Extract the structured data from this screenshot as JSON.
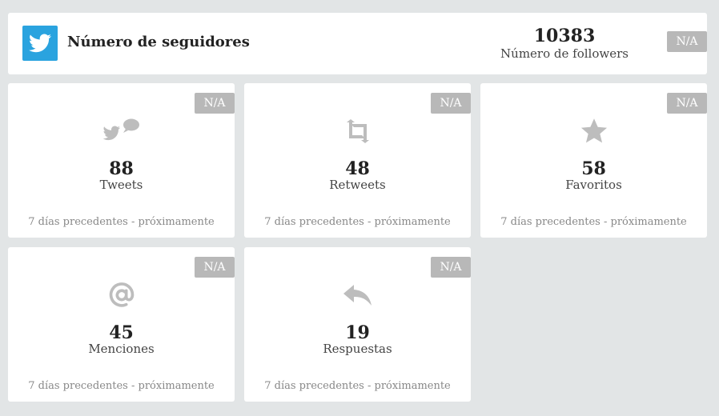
{
  "header": {
    "icon": "twitter-bird-icon",
    "title": "Número de seguidores",
    "value": "10383",
    "label": "Número de followers",
    "badge": "N/A"
  },
  "metrics": [
    {
      "icon": "tweets-bird-speech-icon",
      "value": "88",
      "label": "Tweets",
      "footer": "7 días precedentes - próximamente",
      "badge": "N/A"
    },
    {
      "icon": "retweet-icon",
      "value": "48",
      "label": "Retweets",
      "footer": "7 días precedentes - próximamente",
      "badge": "N/A"
    },
    {
      "icon": "star-icon",
      "value": "58",
      "label": "Favoritos",
      "footer": "7 días precedentes - próximamente",
      "badge": "N/A"
    },
    {
      "icon": "at-sign-icon",
      "value": "45",
      "label": "Menciones",
      "footer": "7 días precedentes - próximamente",
      "badge": "N/A"
    },
    {
      "icon": "reply-icon",
      "value": "19",
      "label": "Respuestas",
      "footer": "7 días precedentes - próximamente",
      "badge": "N/A"
    }
  ],
  "colors": {
    "background": "#e2e5e6",
    "card": "#ffffff",
    "twitter_blue": "#2aa3df",
    "badge": "#b8b8b8",
    "icon_gray": "#bdbdbd"
  }
}
